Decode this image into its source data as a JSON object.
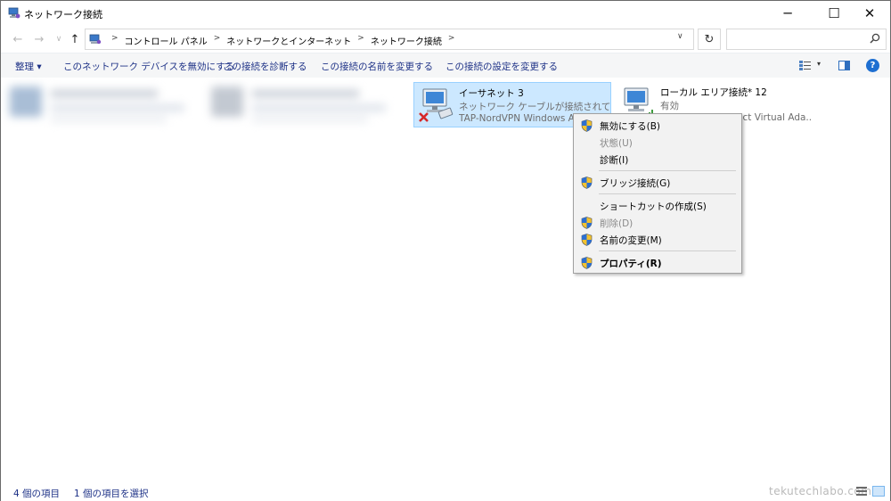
{
  "window": {
    "title": "ネットワーク接続",
    "controls": {
      "minimize": "─",
      "maximize": "☐",
      "close": "✕"
    }
  },
  "navigation": {
    "back": "←",
    "forward": "→",
    "recent": "∨",
    "up": "↑",
    "breadcrumbs": [
      "コントロール パネル",
      "ネットワークとインターネット",
      "ネットワーク接続"
    ],
    "separator": ">",
    "dropdown": "∨",
    "refresh": "↻",
    "search_placeholder": ""
  },
  "command_bar": {
    "organize": "整理 ▾",
    "disable": "このネットワーク デバイスを無効にする",
    "diagnose": "この接続を診断する",
    "rename": "この接続の名前を変更する",
    "settings": "この接続の設定を変更する",
    "view_caret": "▾",
    "help": "?"
  },
  "connections": [
    {
      "name": "イーサネット 3",
      "status": "ネットワーク ケーブルが接続されていま...",
      "device": "TAP-NordVPN Windows Ad",
      "selected": true,
      "state": "disconnected"
    },
    {
      "name": "ローカル エリア接続* 12",
      "status": "有効",
      "device": "ect Virtual Ada...",
      "selected": false,
      "state": "enabled"
    }
  ],
  "context_menu": {
    "items": [
      {
        "label": "無効にする(B)",
        "shield": true,
        "disabled": false,
        "bold": false
      },
      {
        "label": "状態(U)",
        "shield": false,
        "disabled": true,
        "bold": false
      },
      {
        "label": "診断(I)",
        "shield": false,
        "disabled": false,
        "bold": false
      },
      {
        "label": "ブリッジ接続(G)",
        "shield": true,
        "disabled": false,
        "bold": false
      },
      {
        "label": "ショートカットの作成(S)",
        "shield": false,
        "disabled": false,
        "bold": false
      },
      {
        "label": "削除(D)",
        "shield": true,
        "disabled": true,
        "bold": false
      },
      {
        "label": "名前の変更(M)",
        "shield": true,
        "disabled": false,
        "bold": false
      },
      {
        "label": "プロパティ(R)",
        "shield": true,
        "disabled": false,
        "bold": true
      }
    ]
  },
  "status_bar": {
    "item_count": "4 個の項目",
    "selected_count": "1 個の項目を選択"
  },
  "watermark": "tekutechlabo.com",
  "colors": {
    "selection_bg": "#cce8ff",
    "selection_border": "#99d1ff",
    "link_blue": "#1e3287",
    "help_blue": "#1e6fd1"
  }
}
